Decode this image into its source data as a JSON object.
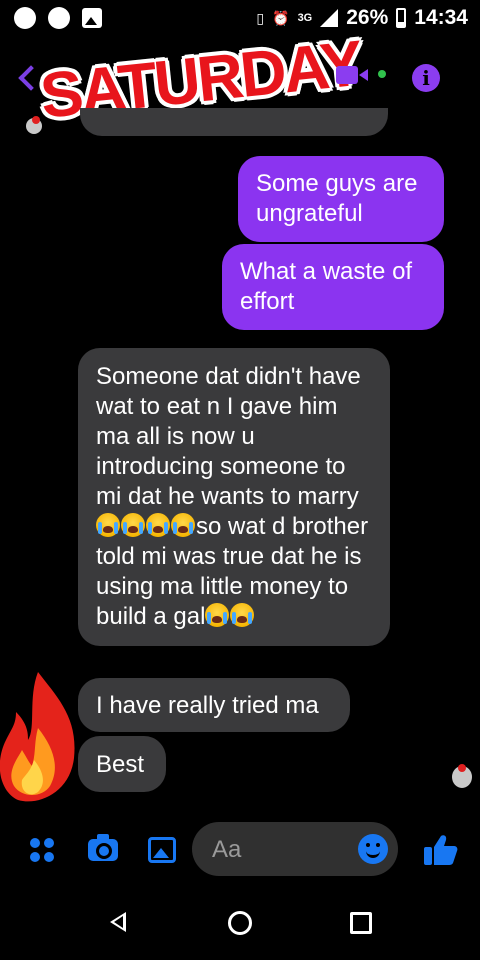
{
  "status_bar": {
    "network": "3G",
    "battery": "26%",
    "time": "14:34",
    "left_icons": [
      "whatsapp-icon",
      "messenger-icon",
      "gallery-icon"
    ]
  },
  "header": {
    "sticker_text": "SATURDAY",
    "actions": [
      "video-call-icon",
      "online-dot-icon",
      "info-icon"
    ],
    "accent_color": "#8b3df0"
  },
  "messages": [
    {
      "side": "outgoing",
      "text": "Some guys are ungrateful"
    },
    {
      "side": "outgoing",
      "text": "What a waste of effort"
    },
    {
      "side": "incoming",
      "parts": [
        "Someone dat didn't have wat to eat n I gave him ma all is now u introducing someone to mi dat he wants to marry",
        "so wat d brother told mi was true dat he is using ma little money to build a gal"
      ],
      "emoji_after_part": [
        4,
        2
      ]
    },
    {
      "side": "incoming",
      "text": "I have really tried ma"
    },
    {
      "side": "incoming",
      "text": "Best"
    }
  ],
  "composer": {
    "placeholder": "Aa",
    "icons": [
      "menu-dots-icon",
      "camera-icon",
      "gallery-icon",
      "emoji-icon",
      "thumbs-up-icon"
    ],
    "icon_color": "#1877f2"
  },
  "navbar": {
    "icons": [
      "back-icon",
      "home-icon",
      "recent-apps-icon"
    ]
  }
}
